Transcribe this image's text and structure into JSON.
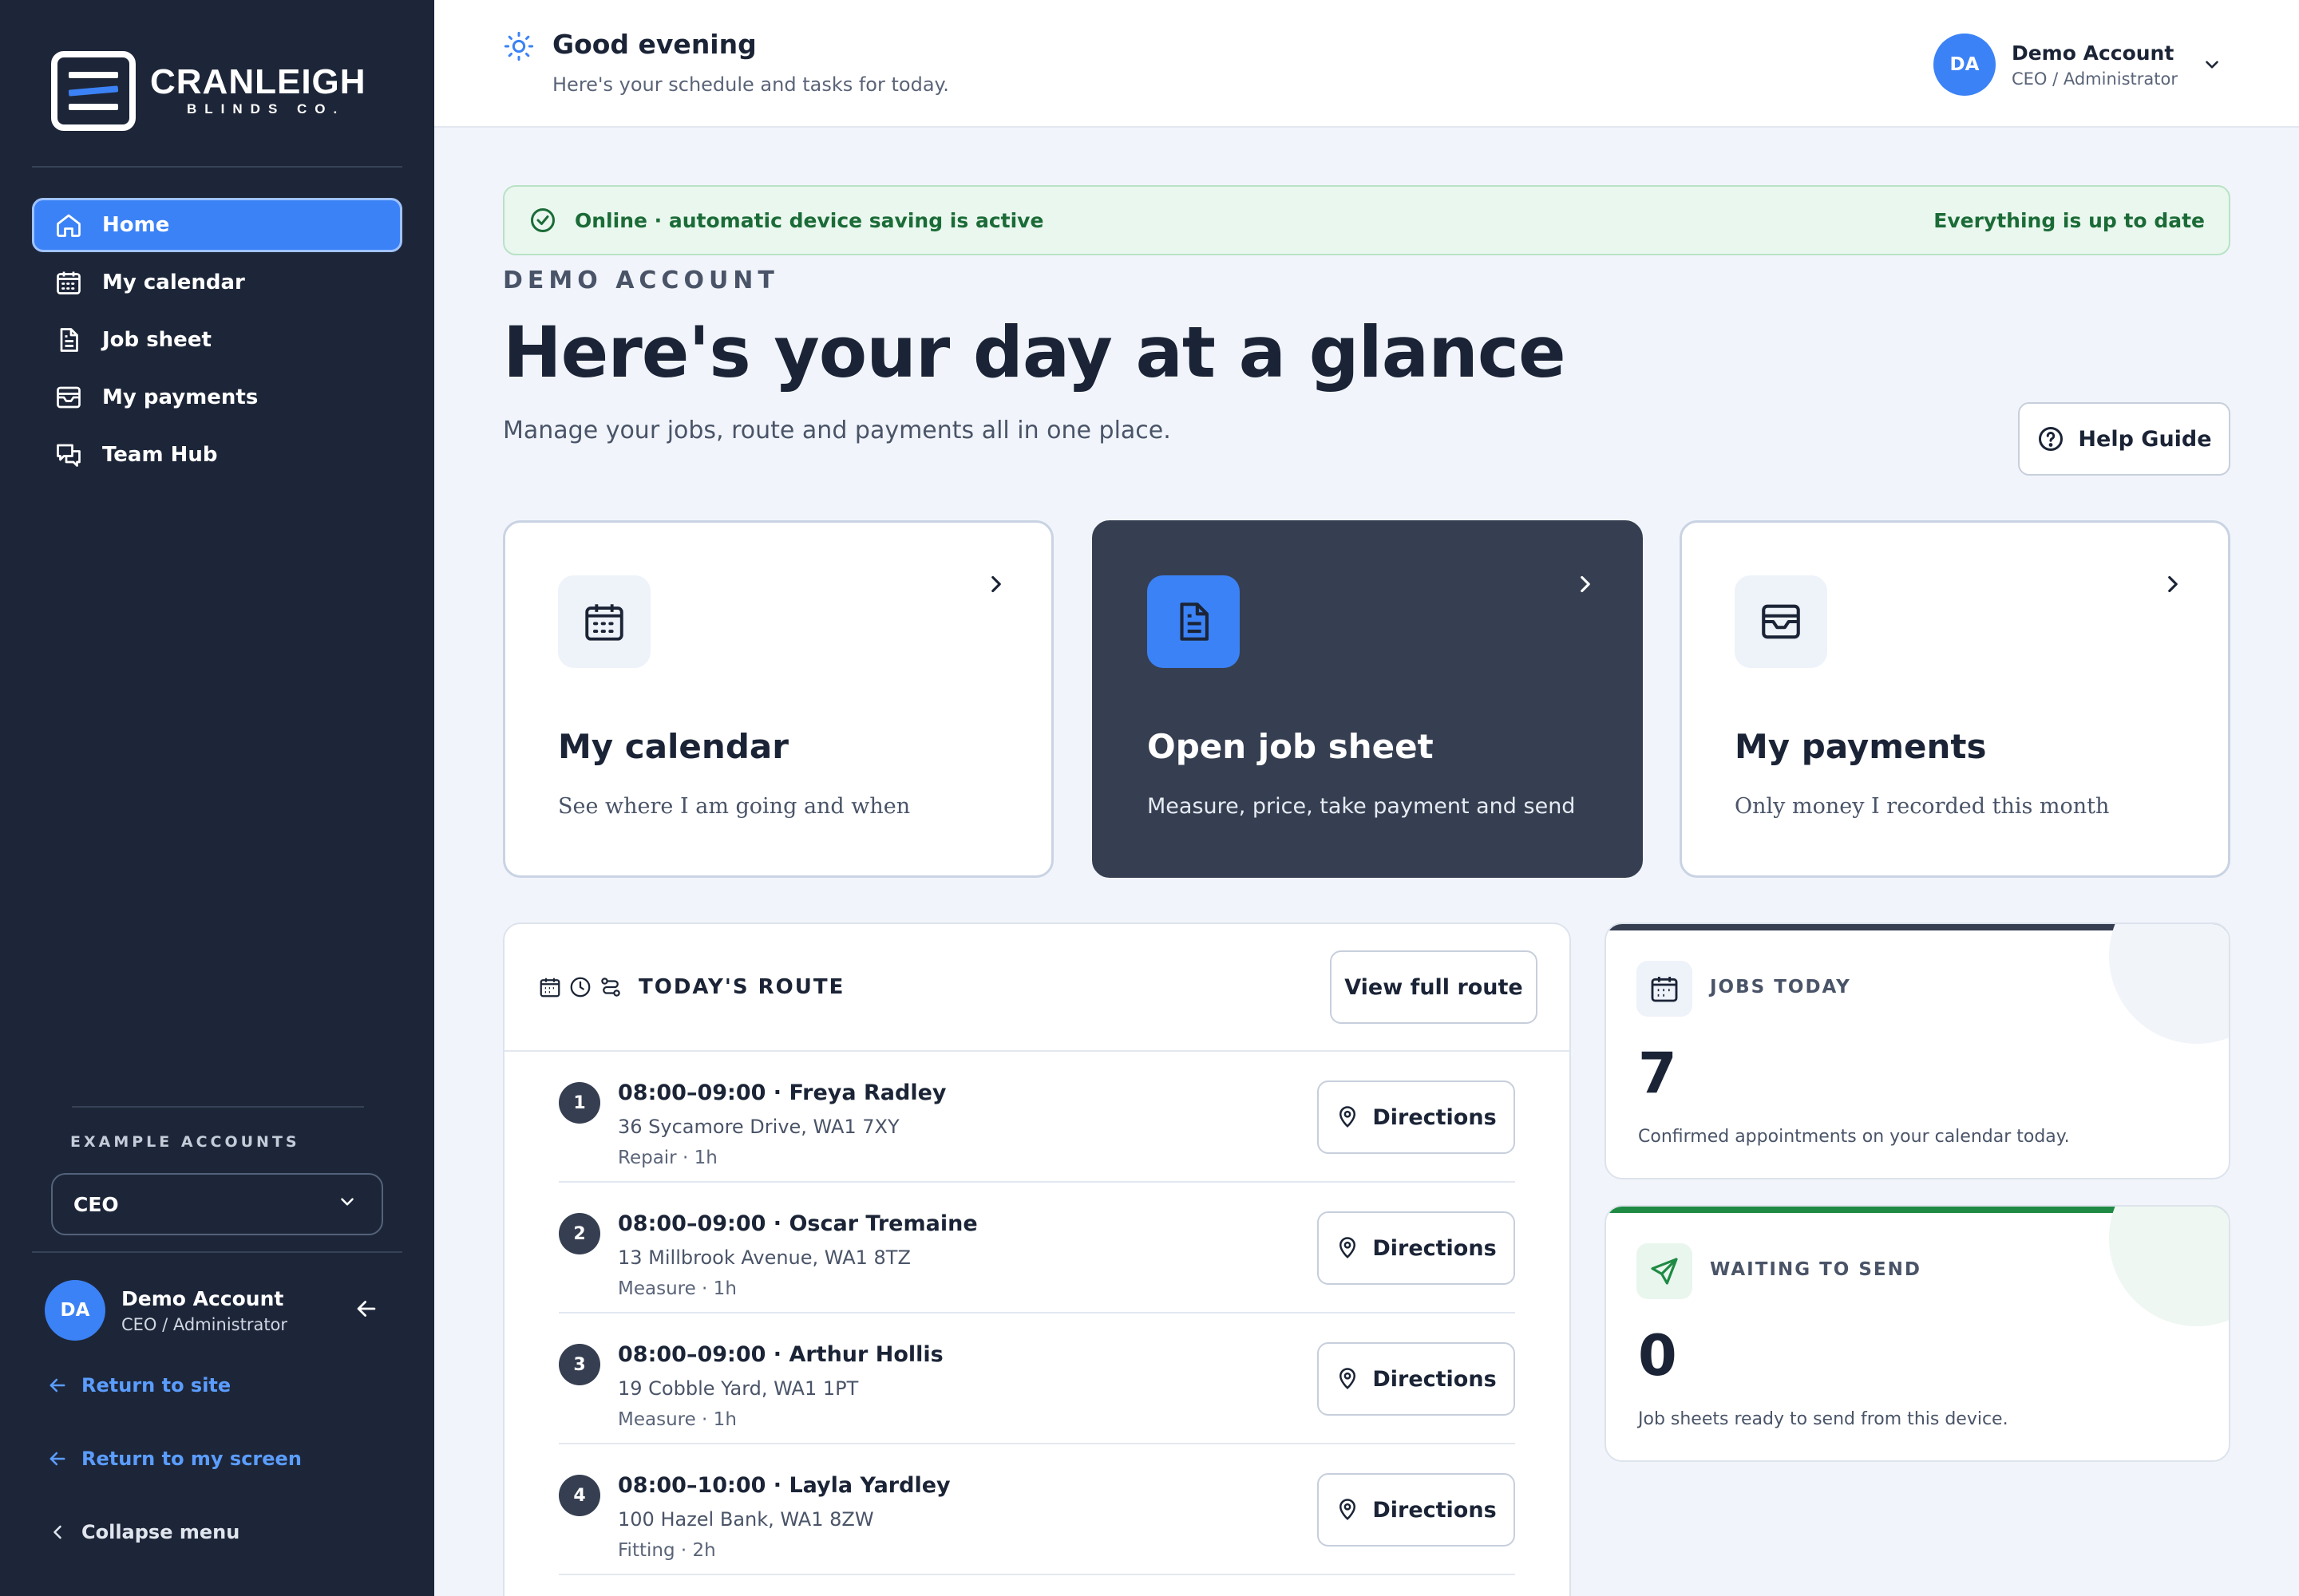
{
  "brand": {
    "name": "CRANLEIGH",
    "sub": "BLINDS CO.",
    "accent": "#3b82f6",
    "sidebar_bg": "#1d2638"
  },
  "sidebar": {
    "items": [
      {
        "label": "Home",
        "icon": "home-icon",
        "active": true
      },
      {
        "label": "My calendar",
        "icon": "calendar-icon"
      },
      {
        "label": "Job sheet",
        "icon": "document-icon"
      },
      {
        "label": "My payments",
        "icon": "wallet-icon"
      },
      {
        "label": "Team Hub",
        "icon": "chat-icon"
      }
    ],
    "example_label": "EXAMPLE ACCOUNTS",
    "example_value": "CEO",
    "user": {
      "initials": "DA",
      "name": "Demo Account",
      "role": "CEO / Administrator"
    },
    "return_site": "Return to site",
    "return_screen": "Return to my screen",
    "collapse": "Collapse menu"
  },
  "header": {
    "greeting": "Good evening",
    "subtitle": "Here's your schedule and tasks for today.",
    "user": {
      "initials": "DA",
      "name": "Demo Account",
      "role": "CEO / Administrator"
    }
  },
  "banner": {
    "status": "Online · automatic device saving is active",
    "right": "Everything is up to date"
  },
  "main": {
    "eyebrow": "DEMO ACCOUNT",
    "title": "Here's your day at a glance",
    "subtitle": "Manage your jobs, route and payments all in one place.",
    "help": "Help Guide"
  },
  "cards": [
    {
      "title": "My calendar",
      "desc": "See where I am going and when"
    },
    {
      "title": "Open job sheet",
      "desc": "Measure, price, take payment and send"
    },
    {
      "title": "My payments",
      "desc": "Only money I recorded this month"
    }
  ],
  "route": {
    "title": "TODAY'S ROUTE",
    "view_button": "View full route",
    "directions": "Directions",
    "stops": [
      {
        "num": "1",
        "title": "08:00–09:00 · Freya Radley",
        "address": "36 Sycamore Drive, WA1 7XY",
        "type": "Repair · 1h"
      },
      {
        "num": "2",
        "title": "08:00–09:00 · Oscar Tremaine",
        "address": "13 Millbrook Avenue, WA1 8TZ",
        "type": "Measure · 1h"
      },
      {
        "num": "3",
        "title": "08:00–09:00 · Arthur Hollis",
        "address": "19 Cobble Yard, WA1 1PT",
        "type": "Measure · 1h"
      },
      {
        "num": "4",
        "title": "08:00–10:00 · Layla Yardley",
        "address": "100 Hazel Bank, WA1 8ZW",
        "type": "Fitting · 2h"
      }
    ]
  },
  "stats": {
    "jobs": {
      "label": "JOBS TODAY",
      "value": "7",
      "desc": "Confirmed appointments on your calendar today.",
      "color": "#363f51"
    },
    "waiting": {
      "label": "WAITING TO SEND",
      "value": "0",
      "desc": "Job sheets ready to send from this device.",
      "color": "#1f8a43"
    }
  }
}
